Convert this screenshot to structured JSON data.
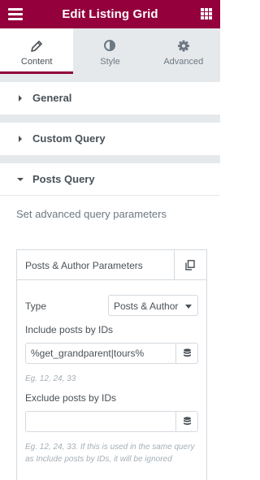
{
  "header": {
    "title": "Edit Listing Grid",
    "menu_icon": "hamburger-icon",
    "apps_icon": "grid-icon"
  },
  "tabs": [
    {
      "label": "Content",
      "icon": "pencil-icon",
      "active": true
    },
    {
      "label": "Style",
      "icon": "half-circle-icon",
      "active": false
    },
    {
      "label": "Advanced",
      "icon": "gear-icon",
      "active": false
    }
  ],
  "sections": {
    "general": "General",
    "custom_query": "Custom Query",
    "posts_query": "Posts Query"
  },
  "posts_query": {
    "description": "Set advanced query parameters",
    "repeater": {
      "title": "Posts & Author Parameters",
      "type_label": "Type",
      "type_value": "Posts & Author",
      "include_label": "Include posts by IDs",
      "include_value": "%get_grandparent|tours%",
      "include_note": "Eg. 12, 24, 33",
      "exclude_label": "Exclude posts by IDs",
      "exclude_value": "",
      "exclude_note": "Eg. 12, 24, 33. If this is used in the same query as Include posts by IDs, it will be ignored"
    }
  },
  "colors": {
    "brand": "#93003c",
    "panel_bg": "#e6e9ec",
    "text": "#495157",
    "muted": "#a4afb7",
    "border": "#d5dadf"
  }
}
